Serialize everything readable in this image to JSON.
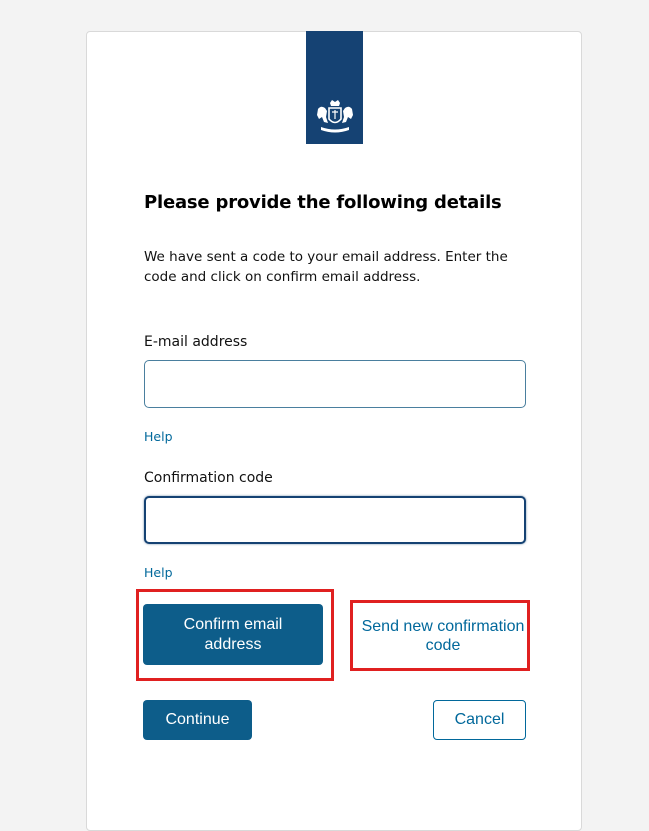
{
  "form": {
    "title": "Please provide the following details",
    "intro": "We have sent a code to your email address. Enter the code and click on confirm email address.",
    "email_label": "E-mail address",
    "email_value": "",
    "email_help": "Help",
    "code_label": "Confirmation code",
    "code_value": "",
    "code_help": "Help"
  },
  "actions": {
    "confirm_email": "Confirm email address",
    "send_new_code": "Send new confirmation code",
    "continue": "Continue",
    "cancel": "Cancel"
  },
  "branding": {
    "logo_icon": "rijksoverheid-coat-of-arms-icon",
    "ribbon_color": "#154273",
    "accent_color": "#01689b",
    "highlight_color": "#e02020"
  }
}
